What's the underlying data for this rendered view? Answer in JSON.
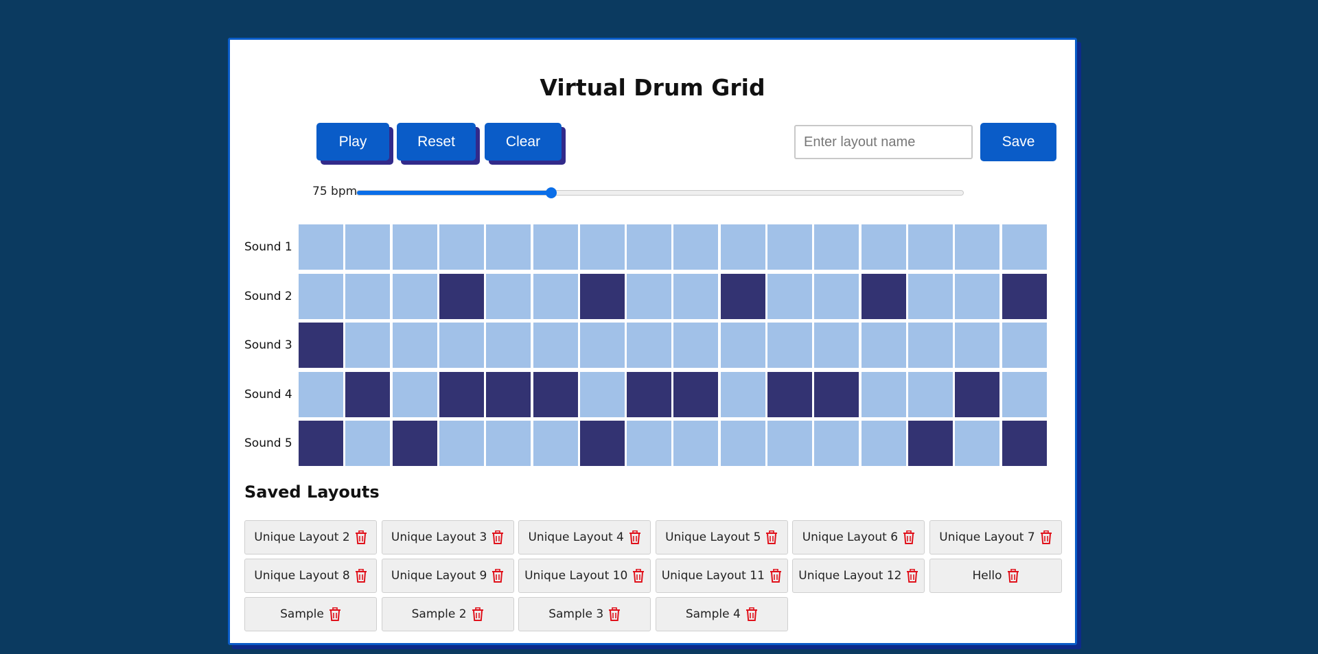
{
  "app": {
    "title": "Virtual Drum Grid"
  },
  "controls": {
    "play_label": "Play",
    "reset_label": "Reset",
    "clear_label": "Clear",
    "save_label": "Save",
    "layout_name_placeholder": "Enter layout name",
    "layout_name_value": ""
  },
  "tempo": {
    "label": "75 bpm",
    "value_fraction": 0.32
  },
  "grid": {
    "rows": [
      {
        "label": "Sound 1",
        "steps": [
          0,
          0,
          0,
          0,
          0,
          0,
          0,
          0,
          0,
          0,
          0,
          0,
          0,
          0,
          0,
          0
        ]
      },
      {
        "label": "Sound 2",
        "steps": [
          0,
          0,
          0,
          1,
          0,
          0,
          1,
          0,
          0,
          1,
          0,
          0,
          1,
          0,
          0,
          1
        ]
      },
      {
        "label": "Sound 3",
        "steps": [
          1,
          0,
          0,
          0,
          0,
          0,
          0,
          0,
          0,
          0,
          0,
          0,
          0,
          0,
          0,
          0
        ]
      },
      {
        "label": "Sound 4",
        "steps": [
          0,
          1,
          0,
          1,
          1,
          1,
          0,
          1,
          1,
          0,
          1,
          1,
          0,
          0,
          1,
          0
        ]
      },
      {
        "label": "Sound 5",
        "steps": [
          1,
          0,
          1,
          0,
          0,
          0,
          1,
          0,
          0,
          0,
          0,
          0,
          0,
          1,
          0,
          1
        ]
      }
    ]
  },
  "saved_layouts": {
    "title": "Saved Layouts",
    "items": [
      "Unique Layout 2",
      "Unique Layout 3",
      "Unique Layout 4",
      "Unique Layout 5",
      "Unique Layout 6",
      "Unique Layout 7",
      "Unique Layout 8",
      "Unique Layout 9",
      "Unique Layout 10",
      "Unique Layout 11",
      "Unique Layout 12",
      "Hello",
      "Sample",
      "Sample 2",
      "Sample 3",
      "Sample 4"
    ],
    "delete_icon": "trash-icon"
  },
  "colors": {
    "background": "#0b3a60",
    "accent": "#0a5cc8",
    "cell_off": "#a1c1e8",
    "cell_on": "#333372",
    "delete": "#e0101a"
  }
}
